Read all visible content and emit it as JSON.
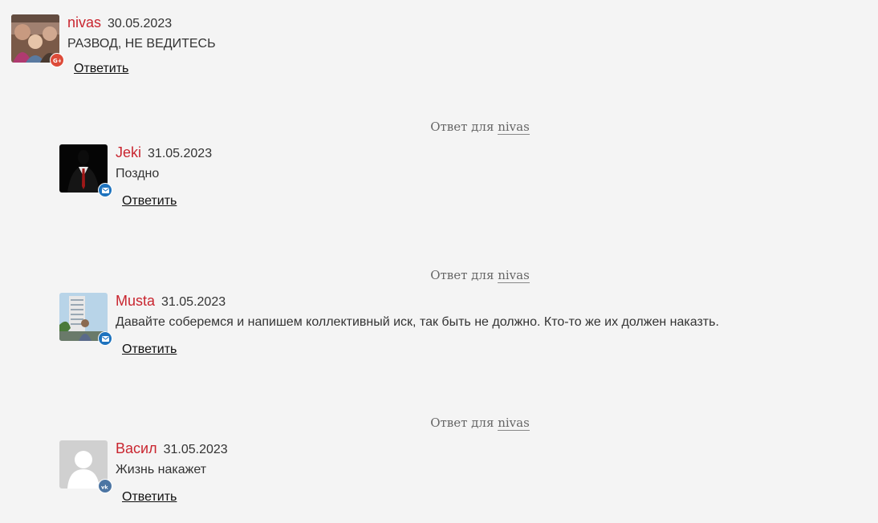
{
  "reply_label": "Ответить",
  "reply_to_prefix": "Ответ для",
  "comments": [
    {
      "author": "nivas",
      "date": "30.05.2023",
      "text": "РАЗВОД, НЕ ВЕДИТЕСЬ",
      "badge_icon": "google-plus-icon",
      "badge_color": "#dd4b39"
    },
    {
      "reply_to": "nivas",
      "author": "Jeki",
      "date": "31.05.2023",
      "text": "Поздно",
      "badge_icon": "mail-icon",
      "badge_color": "#1e73be"
    },
    {
      "reply_to": "nivas",
      "author": "Musta",
      "date": "31.05.2023",
      "text": "Давайте соберемся и напишем коллективный иск, так быть не должно. Кто-то же их должен наказть.",
      "badge_icon": "mail-icon",
      "badge_color": "#1e73be"
    },
    {
      "reply_to": "nivas",
      "author": "Васил",
      "date": "31.05.2023",
      "text": "Жизнь накажет",
      "badge_icon": "vk-icon",
      "badge_color": "#4c75a3"
    }
  ],
  "colors": {
    "author": "#c9252f",
    "background": "#f4f4f4"
  }
}
